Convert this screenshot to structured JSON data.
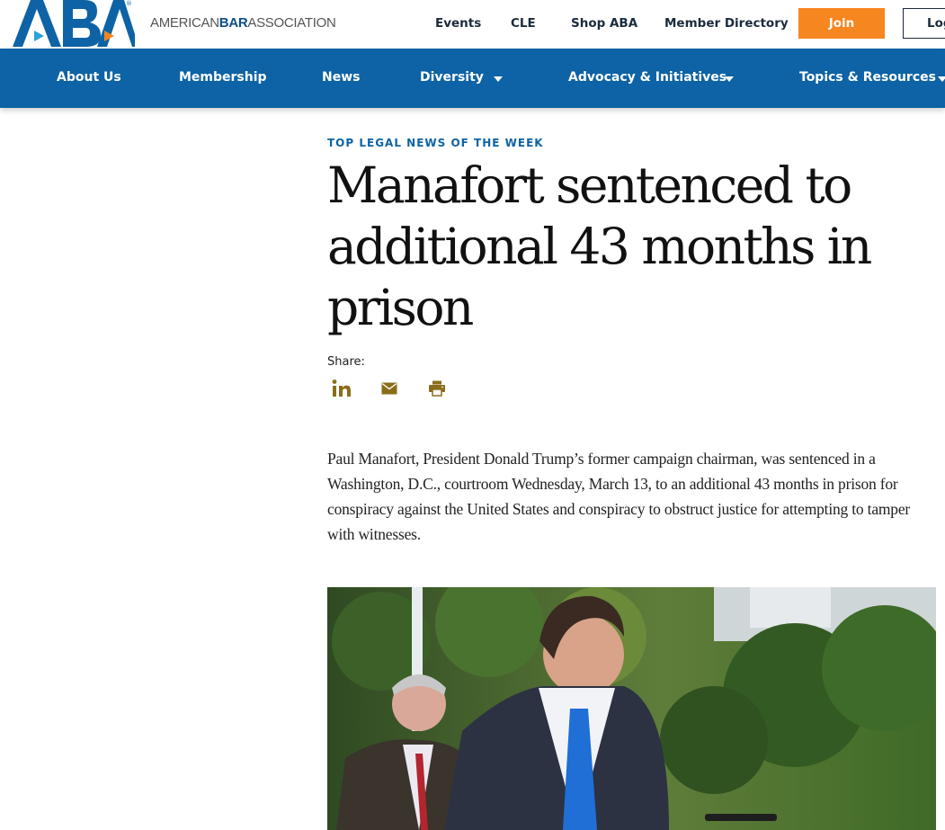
{
  "header": {
    "logo_text": "ABA",
    "wordmark_pre": "AMERICAN",
    "wordmark_bold": "BAR",
    "wordmark_post": "ASSOCIATION",
    "utility_links": [
      "Events",
      "CLE",
      "Shop ABA",
      "Member Directory"
    ],
    "join_label": "Join",
    "login_label": "Log"
  },
  "nav": {
    "items": [
      "About Us",
      "Membership",
      "News",
      "Diversity",
      "Advocacy & Initiatives",
      "Topics & Resources"
    ]
  },
  "article": {
    "kicker": "TOP LEGAL NEWS OF THE WEEK",
    "title": "Manafort sentenced to additional 43 months in prison",
    "share_label": "Share:",
    "share_icons": [
      "linkedin-icon",
      "email-icon",
      "print-icon"
    ],
    "body": "Paul Manafort, President Donald Trump’s former campaign chairman, was sentenced in a Washington, D.C., courtroom Wednesday, March 13, to an additional 43 months in prison for conspiracy against the United States and conspiracy to obstruct justice for attempting to tamper with witnesses."
  },
  "colors": {
    "brand_blue": "#0d63a5",
    "join_orange": "#f6861f",
    "share_gold": "#8a6d1b"
  }
}
